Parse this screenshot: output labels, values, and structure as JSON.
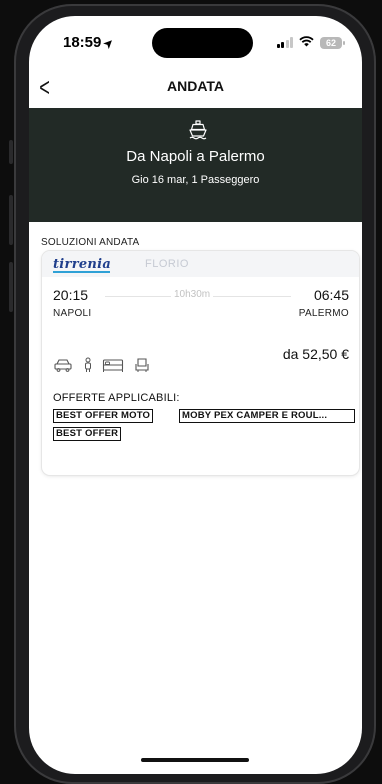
{
  "status_bar": {
    "time": "18:59",
    "battery": "62"
  },
  "header": {
    "title": "ANDATA"
  },
  "trip": {
    "route": "Da Napoli  a  Palermo",
    "date": "Gio 16 mar, 1 Passeggero"
  },
  "section_title": "SOLUZIONI ANDATA",
  "solution": {
    "carrier": "tirrenia",
    "carrier_secondary": "FLORIO",
    "departure_time": "20:15",
    "arrival_time": "06:45",
    "duration": "10h30m",
    "departure_port": "NAPOLI",
    "arrival_port": "PALERMO",
    "price": "da 52,50 €",
    "amenities": [
      "car-icon",
      "passenger-icon",
      "cabin-bed-icon",
      "seat-icon"
    ],
    "offers_title": "OFFERTE APPLICABILI:",
    "offers": [
      "BEST OFFER MOTO",
      "MOBY PEX CAMPER E ROUL...",
      "BEST OFFER"
    ]
  },
  "colors": {
    "banner": "#222a26",
    "brand_blue": "#1f3e8c",
    "brand_light": "#2fa1d6"
  }
}
